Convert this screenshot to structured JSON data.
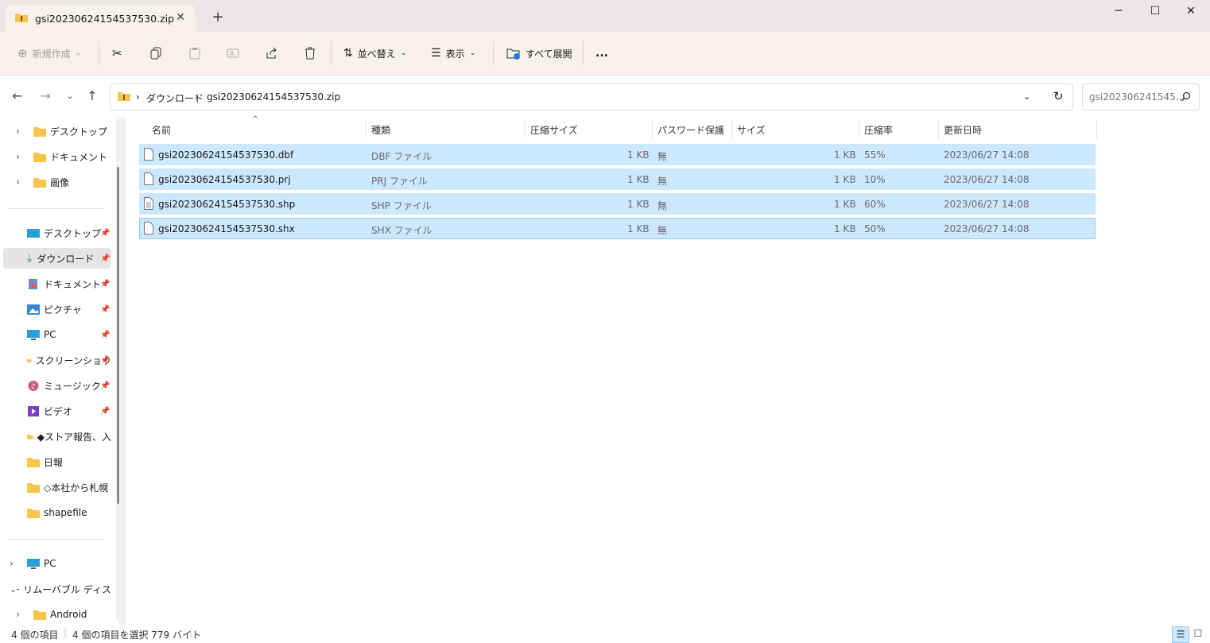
{
  "window": {
    "tab_title": "gsi20230624154537530.zip",
    "tab_close_icon": "close-icon",
    "new_tab_icon": "plus-icon",
    "minimize_icon": "minimize-icon",
    "maximize_icon": "maximize-icon",
    "close_icon": "close-icon"
  },
  "toolbar": {
    "new_label": "新規作成",
    "sort_label": "並べ替え",
    "view_label": "表示",
    "extract_all_label": "すべて展開",
    "more_label": "..."
  },
  "address": {
    "crumbs": [
      "ダウンロード",
      "gsi20230624154537530.zip"
    ],
    "search_placeholder": "gsi202306241545..."
  },
  "sidebar": {
    "top_items": [
      "デスクトップ",
      "ドキュメント",
      "画像"
    ],
    "quick_items": [
      "デスクトップ",
      "ダウンロード",
      "ドキュメント",
      "ピクチャ",
      "PC",
      "スクリーンショッ",
      "ミュージック",
      "ビデオ",
      "◆ストア報告、入",
      "日報",
      "◇本社から札幌",
      "shapefile"
    ],
    "bottom_items": [
      "PC",
      "リムーバブル ディス",
      "Android"
    ]
  },
  "columns": [
    "名前",
    "種類",
    "圧縮サイズ",
    "パスワード保護",
    "サイズ",
    "圧縮率",
    "更新日時"
  ],
  "files": [
    {
      "name": "gsi20230624154537530.dbf",
      "type": "DBF ファイル",
      "packed": "1 KB",
      "password": "無",
      "size": "1 KB",
      "ratio": "55%",
      "date": "2023/06/27 14:08"
    },
    {
      "name": "gsi20230624154537530.prj",
      "type": "PRJ ファイル",
      "packed": "1 KB",
      "password": "無",
      "size": "1 KB",
      "ratio": "10%",
      "date": "2023/06/27 14:08"
    },
    {
      "name": "gsi20230624154537530.shp",
      "type": "SHP ファイル",
      "packed": "1 KB",
      "password": "無",
      "size": "1 KB",
      "ratio": "60%",
      "date": "2023/06/27 14:08"
    },
    {
      "name": "gsi20230624154537530.shx",
      "type": "SHX ファイル",
      "packed": "1 KB",
      "password": "無",
      "size": "1 KB",
      "ratio": "50%",
      "date": "2023/06/27 14:08"
    }
  ],
  "status": {
    "count": "4 個の項目",
    "selected": "4 個の項目を選択  779 バイト"
  },
  "colors": {
    "selection": "#cce8ff",
    "folder": "#f5c64a",
    "titlebar": "#ece6e6"
  }
}
